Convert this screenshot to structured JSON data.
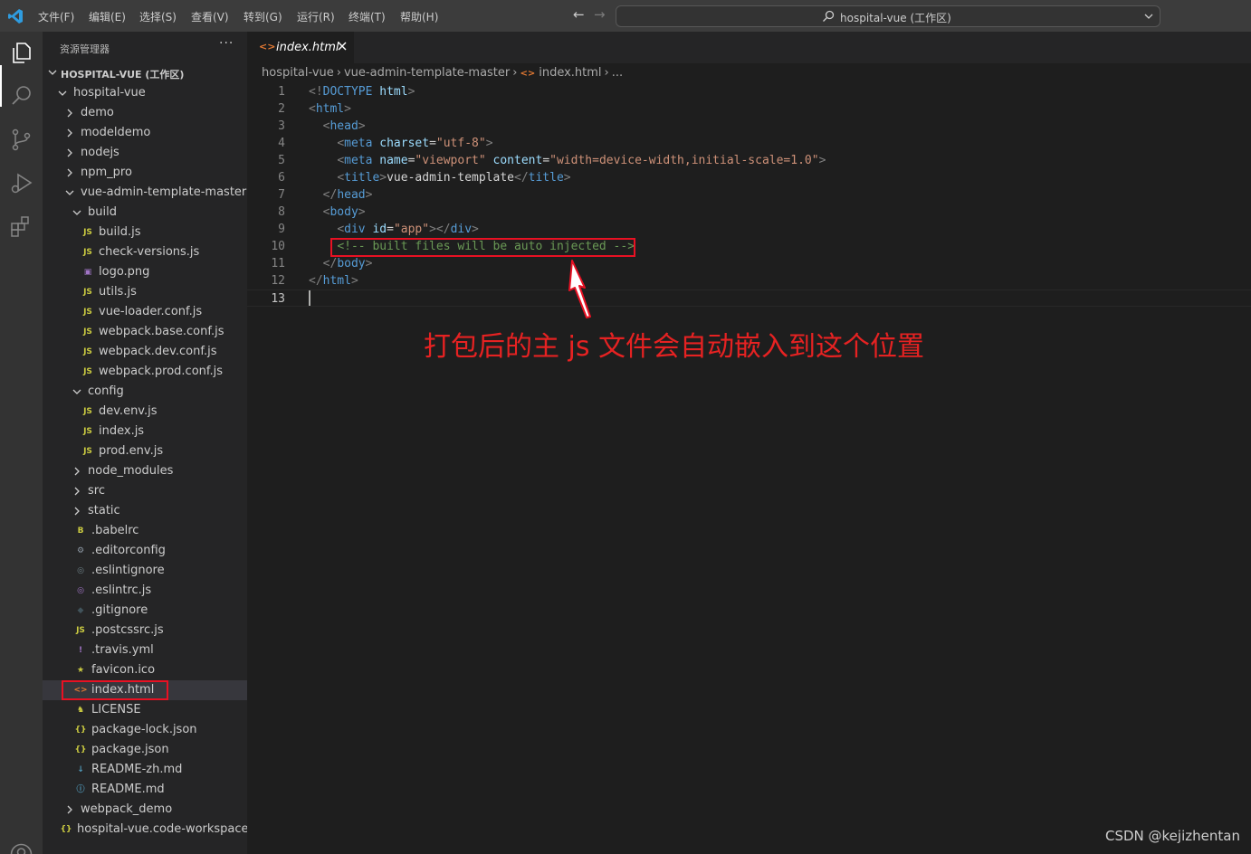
{
  "menu": [
    "文件(F)",
    "编辑(E)",
    "选择(S)",
    "查看(V)",
    "转到(G)",
    "运行(R)",
    "终端(T)",
    "帮助(H)"
  ],
  "command_center": {
    "text": "hospital-vue (工作区)"
  },
  "sidebar": {
    "title": "资源管理器",
    "more": "···",
    "workspace_title": "HOSPITAL-VUE (工作区)",
    "items": [
      {
        "label": "hospital-vue",
        "kind": "folder-open",
        "icon": ""
      },
      {
        "label": "demo",
        "kind": "folder",
        "icon": ""
      },
      {
        "label": "modeldemo",
        "kind": "folder",
        "icon": ""
      },
      {
        "label": "nodejs",
        "kind": "folder",
        "icon": ""
      },
      {
        "label": "npm_pro",
        "kind": "folder",
        "icon": ""
      },
      {
        "label": "vue-admin-template-master",
        "kind": "folder-open",
        "icon": ""
      },
      {
        "label": "build",
        "kind": "folder-open",
        "icon": ""
      },
      {
        "label": "build.js",
        "kind": "file",
        "icon": "JS"
      },
      {
        "label": "check-versions.js",
        "kind": "file",
        "icon": "JS"
      },
      {
        "label": "logo.png",
        "kind": "file",
        "icon": "image"
      },
      {
        "label": "utils.js",
        "kind": "file",
        "icon": "JS"
      },
      {
        "label": "vue-loader.conf.js",
        "kind": "file",
        "icon": "JS"
      },
      {
        "label": "webpack.base.conf.js",
        "kind": "file",
        "icon": "JS"
      },
      {
        "label": "webpack.dev.conf.js",
        "kind": "file",
        "icon": "JS"
      },
      {
        "label": "webpack.prod.conf.js",
        "kind": "file",
        "icon": "JS"
      },
      {
        "label": "config",
        "kind": "folder-open",
        "icon": ""
      },
      {
        "label": "dev.env.js",
        "kind": "file",
        "icon": "JS"
      },
      {
        "label": "index.js",
        "kind": "file",
        "icon": "JS"
      },
      {
        "label": "prod.env.js",
        "kind": "file",
        "icon": "JS"
      },
      {
        "label": "node_modules",
        "kind": "folder",
        "icon": ""
      },
      {
        "label": "src",
        "kind": "folder",
        "icon": ""
      },
      {
        "label": "static",
        "kind": "folder",
        "icon": ""
      },
      {
        "label": ".babelrc",
        "kind": "file",
        "icon": "babel"
      },
      {
        "label": ".editorconfig",
        "kind": "file",
        "icon": "gear"
      },
      {
        "label": ".eslintignore",
        "kind": "file",
        "icon": "eslint-gray"
      },
      {
        "label": ".eslintrc.js",
        "kind": "file",
        "icon": "eslint"
      },
      {
        "label": ".gitignore",
        "kind": "file",
        "icon": "git"
      },
      {
        "label": ".postcssrc.js",
        "kind": "file",
        "icon": "JS"
      },
      {
        "label": ".travis.yml",
        "kind": "file",
        "icon": "yaml"
      },
      {
        "label": "favicon.ico",
        "kind": "file",
        "icon": "star"
      },
      {
        "label": "index.html",
        "kind": "file",
        "icon": "html"
      },
      {
        "label": "LICENSE",
        "kind": "file",
        "icon": "license"
      },
      {
        "label": "package-lock.json",
        "kind": "file",
        "icon": "json"
      },
      {
        "label": "package.json",
        "kind": "file",
        "icon": "json"
      },
      {
        "label": "README-zh.md",
        "kind": "file",
        "icon": "markdown"
      },
      {
        "label": "README.md",
        "kind": "file",
        "icon": "info"
      },
      {
        "label": "webpack_demo",
        "kind": "folder",
        "icon": ""
      },
      {
        "label": "hospital-vue.code-workspace",
        "kind": "file",
        "icon": "json"
      }
    ]
  },
  "editor": {
    "tab_label": "index.html",
    "tab_icon": "<>",
    "breadcrumb": [
      "hospital-vue",
      "vue-admin-template-master",
      "index.html",
      "..."
    ],
    "line_numbers": [
      "1",
      "2",
      "3",
      "4",
      "5",
      "6",
      "7",
      "8",
      "9",
      "10",
      "11",
      "12",
      "13"
    ],
    "current_line": "13"
  },
  "code_lines": [
    [
      [
        "<!",
        "punc"
      ],
      [
        "DOCTYPE",
        "tag"
      ],
      [
        " ",
        "text"
      ],
      [
        "html",
        "attr"
      ],
      [
        ">",
        "punc"
      ]
    ],
    [
      [
        "<",
        "punc"
      ],
      [
        "html",
        "tag"
      ],
      [
        ">",
        "punc"
      ]
    ],
    [
      [
        "  ",
        "text"
      ],
      [
        "<",
        "punc"
      ],
      [
        "head",
        "tag"
      ],
      [
        ">",
        "punc"
      ]
    ],
    [
      [
        "    ",
        "text"
      ],
      [
        "<",
        "punc"
      ],
      [
        "meta",
        "tag"
      ],
      [
        " ",
        "text"
      ],
      [
        "charset",
        "attr"
      ],
      [
        "=",
        "text"
      ],
      [
        "\"utf-8\"",
        "str"
      ],
      [
        ">",
        "punc"
      ]
    ],
    [
      [
        "    ",
        "text"
      ],
      [
        "<",
        "punc"
      ],
      [
        "meta",
        "tag"
      ],
      [
        " ",
        "text"
      ],
      [
        "name",
        "attr"
      ],
      [
        "=",
        "text"
      ],
      [
        "\"viewport\"",
        "str"
      ],
      [
        " ",
        "text"
      ],
      [
        "content",
        "attr"
      ],
      [
        "=",
        "text"
      ],
      [
        "\"width=device-width,initial-scale=1.0\"",
        "str"
      ],
      [
        ">",
        "punc"
      ]
    ],
    [
      [
        "    ",
        "text"
      ],
      [
        "<",
        "punc"
      ],
      [
        "title",
        "tag"
      ],
      [
        ">",
        "punc"
      ],
      [
        "vue-admin-template",
        "text"
      ],
      [
        "</",
        "punc"
      ],
      [
        "title",
        "tag"
      ],
      [
        ">",
        "punc"
      ]
    ],
    [
      [
        "  ",
        "text"
      ],
      [
        "</",
        "punc"
      ],
      [
        "head",
        "tag"
      ],
      [
        ">",
        "punc"
      ]
    ],
    [
      [
        "  ",
        "text"
      ],
      [
        "<",
        "punc"
      ],
      [
        "body",
        "tag"
      ],
      [
        ">",
        "punc"
      ]
    ],
    [
      [
        "    ",
        "text"
      ],
      [
        "<",
        "punc"
      ],
      [
        "div",
        "tag"
      ],
      [
        " ",
        "text"
      ],
      [
        "id",
        "attr"
      ],
      [
        "=",
        "text"
      ],
      [
        "\"app\"",
        "str"
      ],
      [
        "></",
        "punc"
      ],
      [
        "div",
        "tag"
      ],
      [
        ">",
        "punc"
      ]
    ],
    [
      [
        "    ",
        "text"
      ],
      [
        "<!-- built files will be auto injected -->",
        "comment"
      ]
    ],
    [
      [
        "  ",
        "text"
      ],
      [
        "</",
        "punc"
      ],
      [
        "body",
        "tag"
      ],
      [
        ">",
        "punc"
      ]
    ],
    [
      [
        "</",
        "punc"
      ],
      [
        "html",
        "tag"
      ],
      [
        ">",
        "punc"
      ]
    ],
    []
  ],
  "colors": {
    "punc": "#808080",
    "tag": "#569cd6",
    "attr": "#9cdcfe",
    "str": "#ce9178",
    "text": "#d4d4d4",
    "comment": "#6a9955",
    "annotation": "#e62222",
    "js_icon": "#cbcb41",
    "html_icon": "#e37933"
  },
  "annotation": {
    "text": "打包后的主 js 文件会自动嵌入到这个位置"
  },
  "watermark": "CSDN @kejizhentan"
}
